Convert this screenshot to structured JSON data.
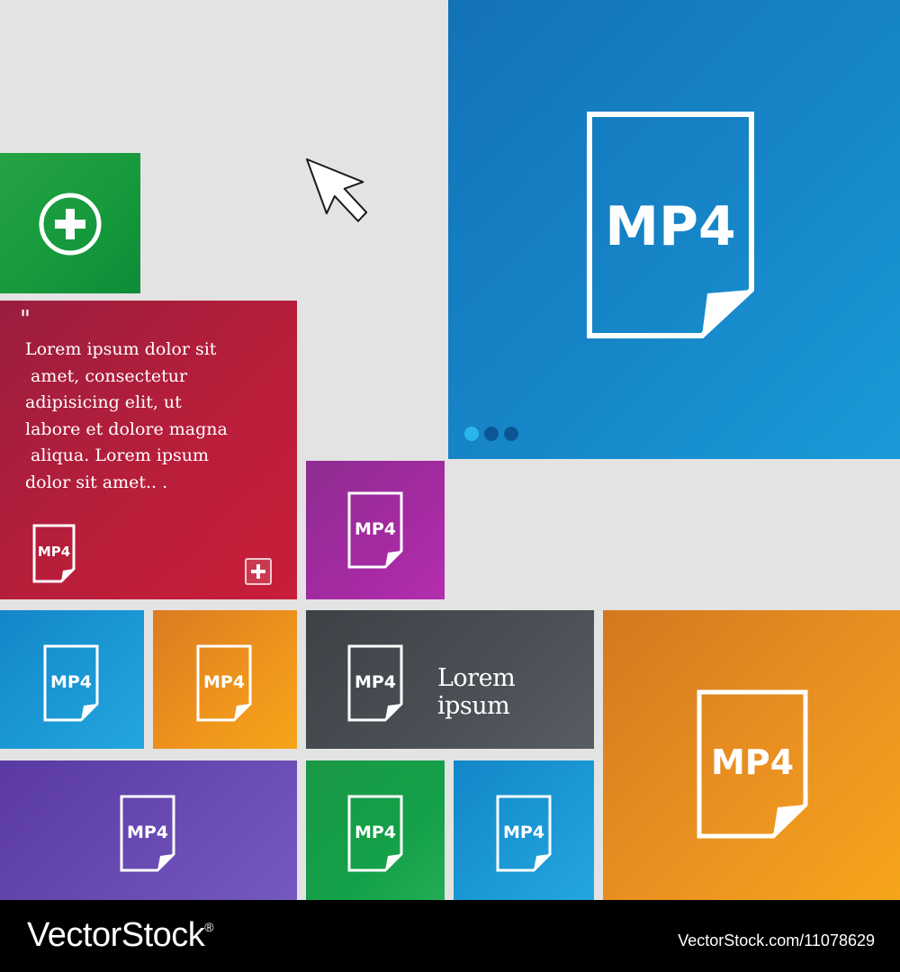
{
  "tiles": {
    "blue_large": {
      "label": "MP4",
      "page_indicator": {
        "count": 3,
        "active": 1
      }
    },
    "red_text": {
      "quote_mark": "\"",
      "lines": [
        "Lorem ipsum dolor sit",
        " amet, consectetur",
        "adipisicing elit, ut",
        "labore et dolore magna",
        " aliqua. Lorem ipsum",
        "dolor sit amet.. ."
      ],
      "file_label": "MP4"
    },
    "purple_small": {
      "label": "MP4"
    },
    "blue_a": {
      "label": "MP4"
    },
    "orange_a": {
      "label": "MP4"
    },
    "dark_text": {
      "label": "MP4",
      "caption": "Lorem ipsum"
    },
    "orange_large": {
      "label": "MP4"
    },
    "purple_wide": {
      "label": "MP4"
    },
    "green_b": {
      "label": "MP4"
    },
    "blue_b": {
      "label": "MP4"
    }
  },
  "footer": {
    "brand": "VectorStock",
    "brand_mark": "®",
    "image_credit": "VectorStock.com/11078629"
  },
  "icons": [
    "plus-circle-icon",
    "cursor-arrow-icon",
    "mp4-file-icon",
    "plus-square-icon"
  ],
  "colors": {
    "background": "#e3e3e3",
    "green": "#169a3c",
    "blue": "#1686c8",
    "red": "#b81e3a",
    "purple": "#a52aa2",
    "orange": "#ef951c",
    "dark": "#4b5056",
    "violet": "#6a4cb4",
    "dot_active": "#29b6ef",
    "dot_inactive": "#0d5696"
  }
}
